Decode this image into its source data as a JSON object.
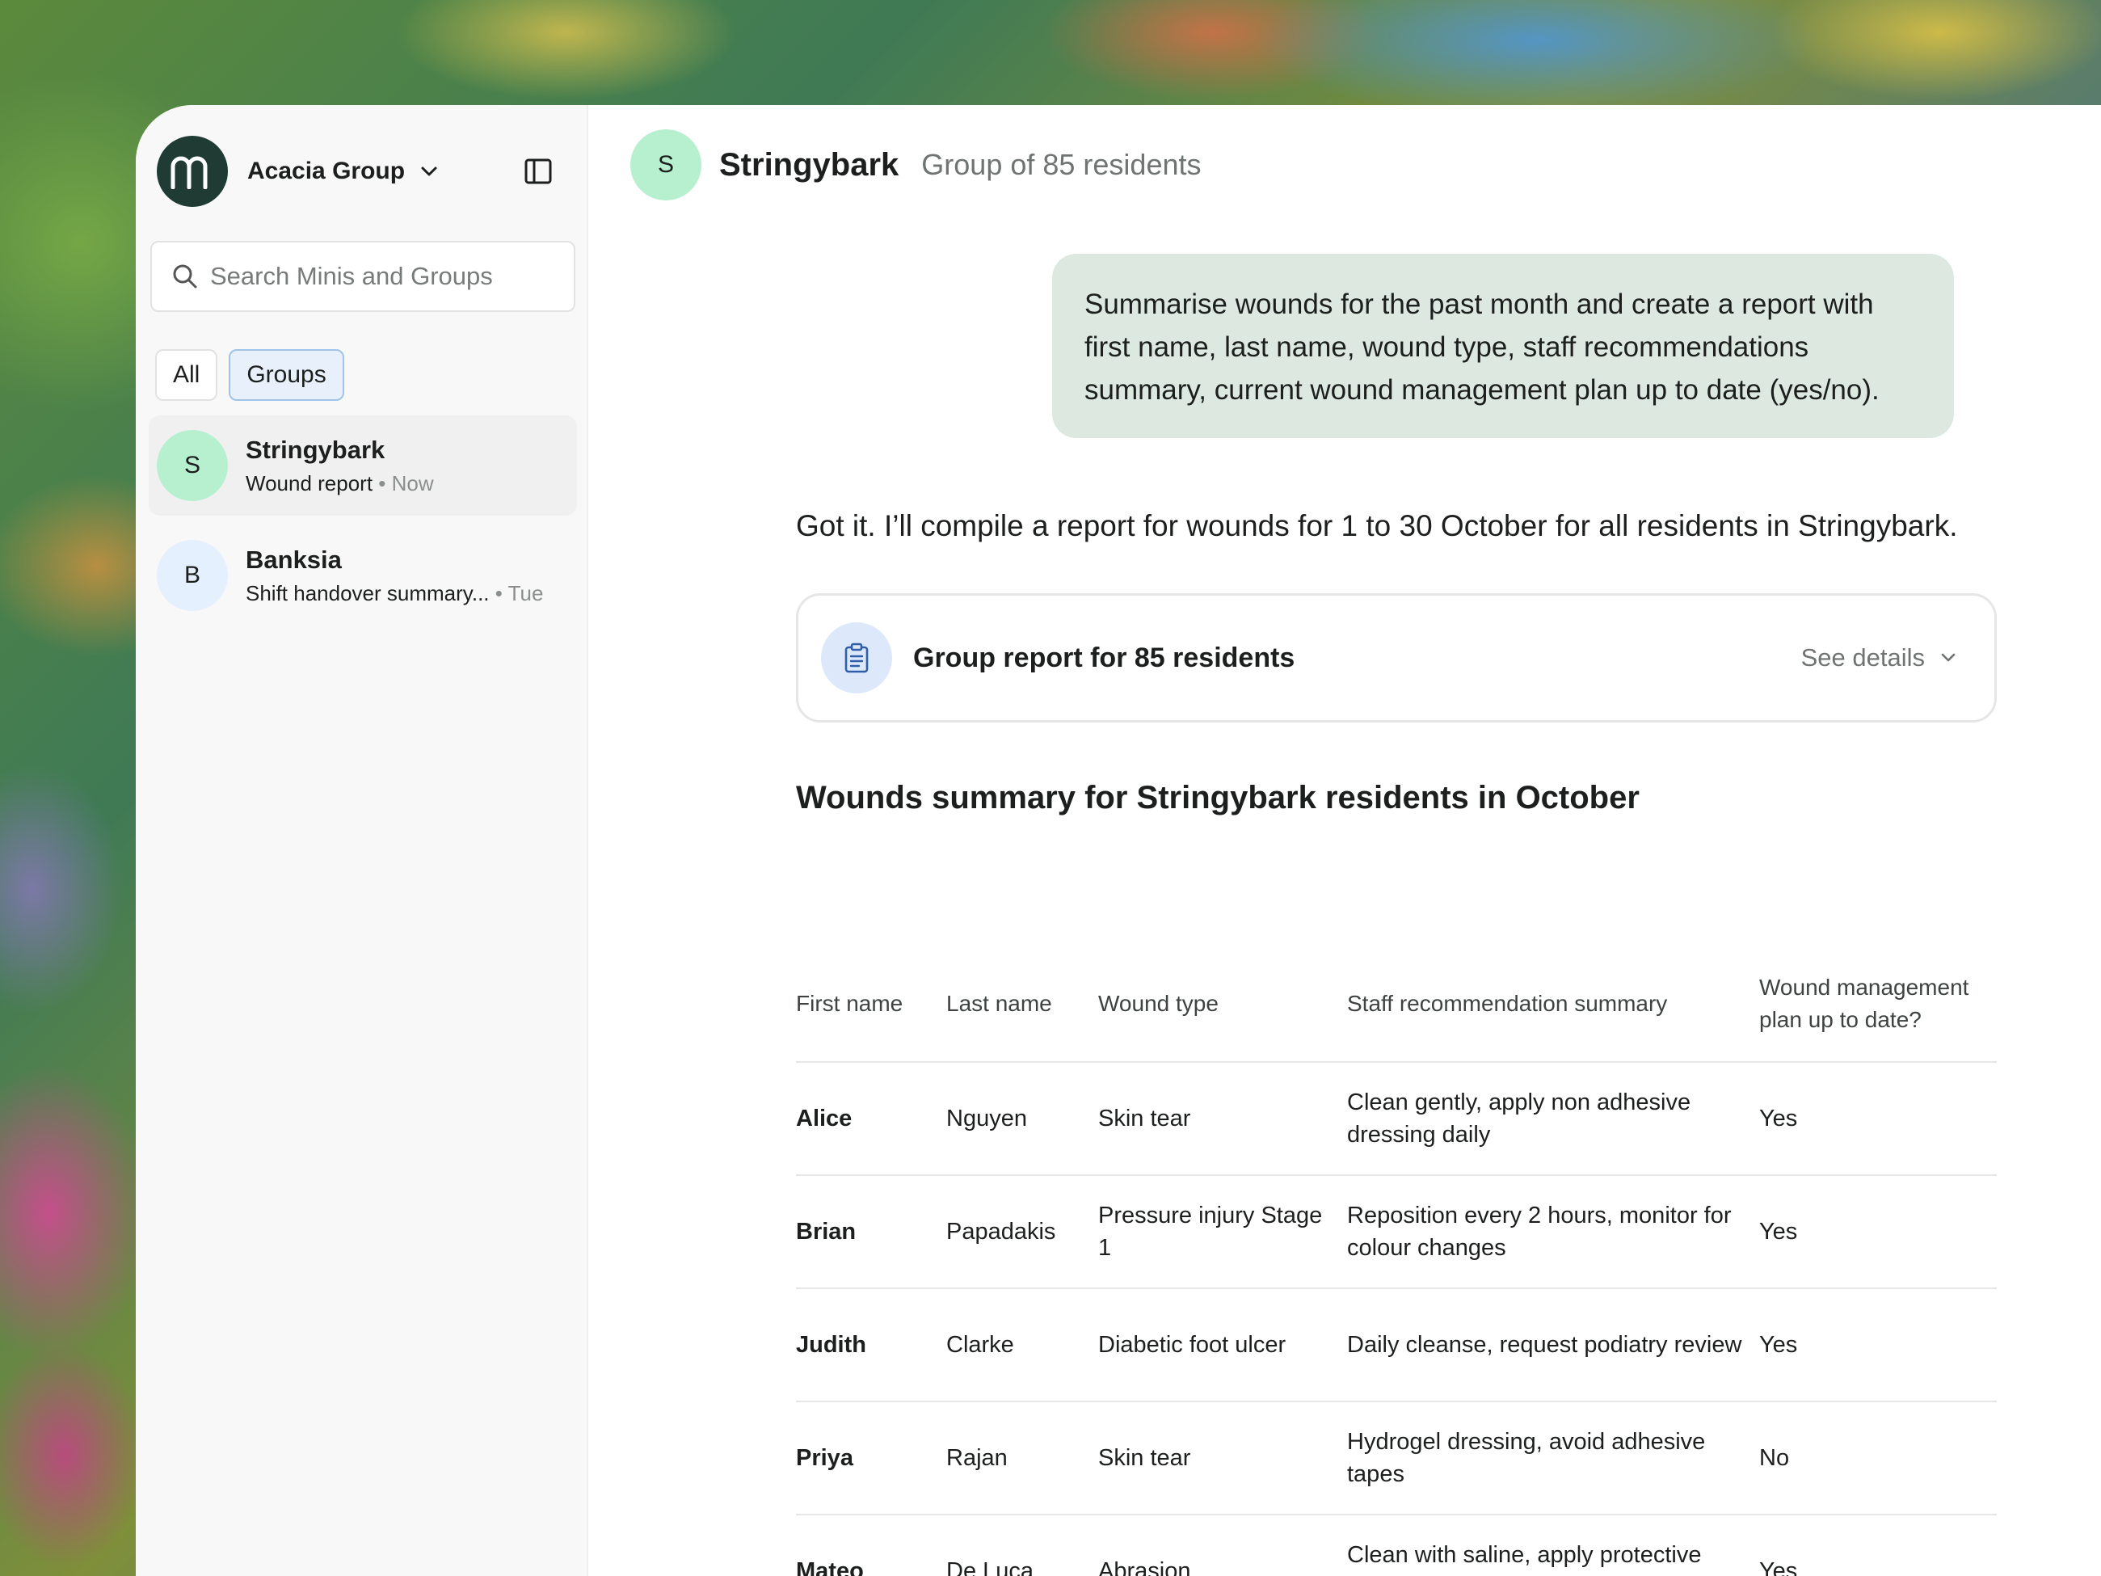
{
  "org": {
    "logo_letter": "m",
    "name": "Acacia Group"
  },
  "search": {
    "placeholder": "Search Minis and Groups"
  },
  "filters": {
    "all": "All",
    "groups": "Groups"
  },
  "conversations": [
    {
      "avatar": "S",
      "title": "Stringybark",
      "subtitle": "Wound report",
      "dot": "•",
      "time": "Now",
      "avatar_color": "#b7f0cf"
    },
    {
      "avatar": "B",
      "title": "Banksia",
      "subtitle": "Shift handover summary...",
      "dot": "•",
      "time": "Tue",
      "avatar_color": "#e4f0fd"
    }
  ],
  "header": {
    "avatar": "S",
    "name": "Stringybark",
    "description": "Group of 85 residents"
  },
  "chat": {
    "user_message": "Summarise wounds for the past month and create a report with first name, last name, wound type, staff recommendations summary, current wound management plan up to date (yes/no).",
    "assistant_reply": "Got it. I’ll compile a report for wounds for 1 to 30 October for all residents in Stringybark."
  },
  "report_card": {
    "title": "Group report for 85 residents",
    "see_details": "See details"
  },
  "summary": {
    "title": "Wounds summary for Stringybark residents in October",
    "columns": [
      "First name",
      "Last name",
      "Wound type",
      "Staff recommendation summary",
      "Wound management plan up to date?"
    ],
    "rows": [
      [
        "Alice",
        "Nguyen",
        "Skin tear",
        "Clean gently, apply non adhesive dressing daily",
        "Yes"
      ],
      [
        "Brian",
        "Papadakis",
        "Pressure injury Stage 1",
        "Reposition every 2 hours, monitor for colour changes",
        "Yes"
      ],
      [
        "Judith",
        "Clarke",
        "Diabetic foot ulcer",
        "Daily cleanse, request podiatry review",
        "Yes"
      ],
      [
        "Priya",
        "Rajan",
        "Skin tear",
        "Hydrogel dressing, avoid adhesive tapes",
        "No"
      ],
      [
        "Mateo",
        "De Luca",
        "Abrasion",
        "Clean with saline, apply protective barrier",
        "Yes"
      ]
    ]
  },
  "colors": {
    "accent_green": "#b7f0cf",
    "bubble": "#dde8e0",
    "logo_bg": "#1f3b34",
    "chip_active": "#e8f1fb"
  }
}
